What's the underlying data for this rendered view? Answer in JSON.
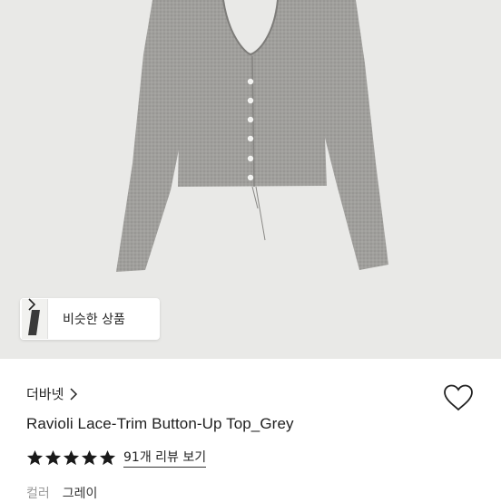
{
  "product": {
    "similar_label": "비슷한 상품",
    "brand": "더바넷",
    "title": "Ravioli Lace-Trim Button-Up Top_Grey",
    "rating": 5,
    "review_text": "91개 리뷰 보기",
    "color_label": "컬러",
    "color_value": "그레이"
  },
  "colors": {
    "star": "#1a1a1a",
    "garment": "#9e9d9a",
    "background": "#e9e9e7"
  },
  "icons": {
    "heart": "heart-outline-icon",
    "chevron": "chevron-right-icon",
    "star": "star-icon"
  }
}
